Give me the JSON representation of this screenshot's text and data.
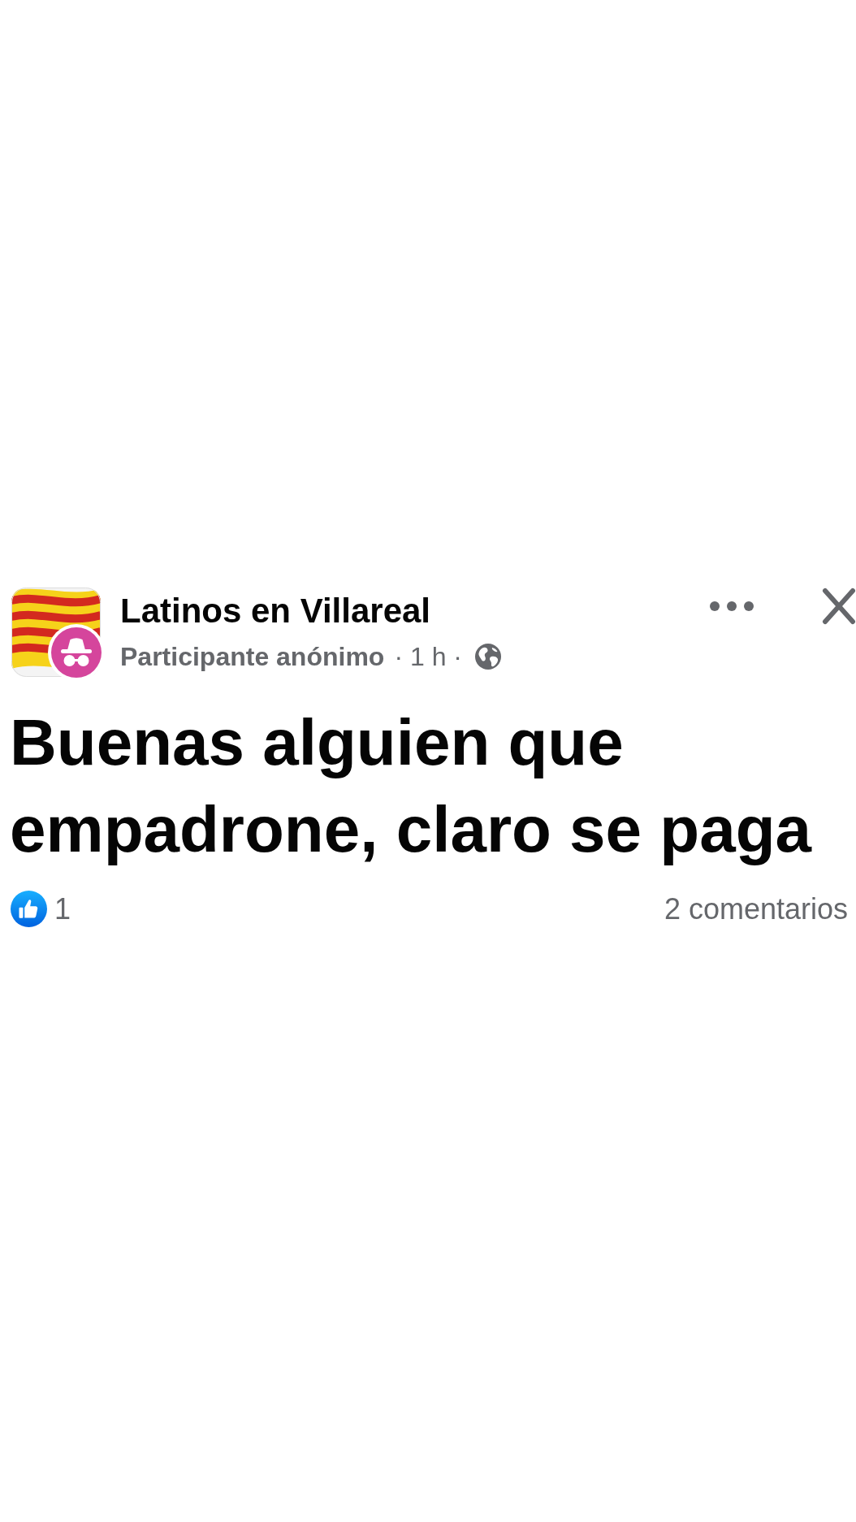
{
  "post": {
    "group_name": "Latinos en Villareal",
    "author": "Participante anónimo",
    "time": "· 1 h ·",
    "body": "Buenas alguien que empadrone, claro se paga",
    "reactions": {
      "count": "1"
    },
    "comments": "2 comentarios"
  }
}
